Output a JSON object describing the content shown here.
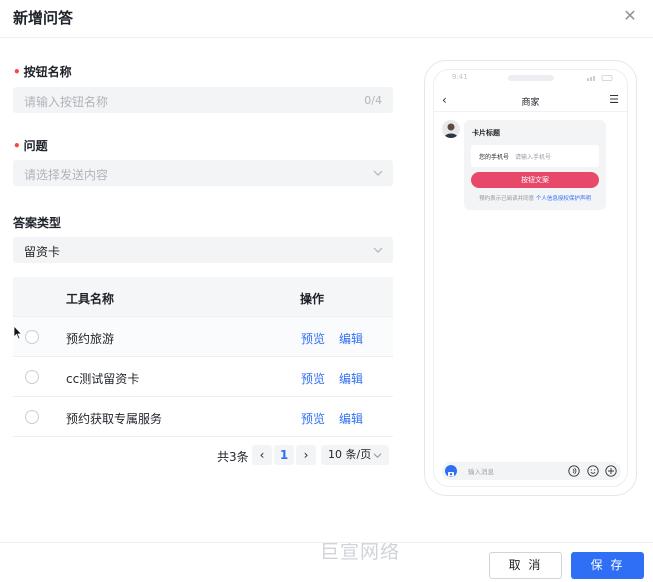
{
  "dialog": {
    "title": "新增问答",
    "close_icon": "close-icon"
  },
  "form": {
    "button_name": {
      "label": "按钮名称",
      "required": true,
      "placeholder": "请输入按钮名称",
      "count": "0/4"
    },
    "question": {
      "label": "问题",
      "required": true,
      "placeholder": "请选择发送内容"
    },
    "answer_type": {
      "label": "答案类型",
      "value": "留资卡"
    }
  },
  "table": {
    "headers": {
      "name": "工具名称",
      "action": "操作"
    },
    "rows": [
      {
        "name": "预约旅游",
        "preview": "预览",
        "edit": "编辑"
      },
      {
        "name": "cc测试留资卡",
        "preview": "预览",
        "edit": "编辑"
      },
      {
        "name": "预约获取专属服务",
        "preview": "预览",
        "edit": "编辑"
      }
    ]
  },
  "pagination": {
    "total": "共3条",
    "current_page": "1",
    "page_size": "10 条/页"
  },
  "preview": {
    "nav_title": "商家",
    "card_title": "卡片标题",
    "field_label": "您的手机号",
    "field_placeholder": "请输入手机号",
    "button_text": "按钮文案",
    "note_prefix": "预约表示已阅读并同意",
    "note_link": "个人信息授权保护声明",
    "input_placeholder": "输入消息",
    "accent_color": "#e8496a"
  },
  "watermark": "巨宣网络",
  "footer": {
    "cancel": "取 消",
    "save": "保 存"
  },
  "colors": {
    "primary": "#2f6ff5",
    "required": "#f54a45"
  }
}
